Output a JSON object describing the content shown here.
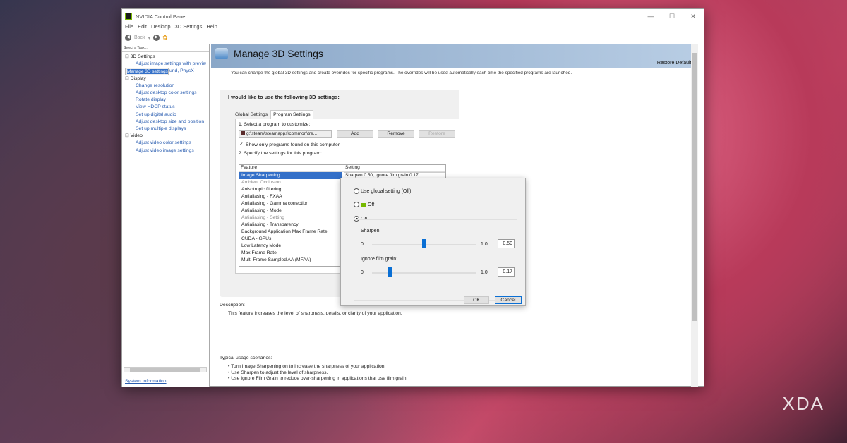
{
  "window": {
    "title": "NVIDIA Control Panel",
    "menu": [
      "File",
      "Edit",
      "Desktop",
      "3D Settings",
      "Help"
    ],
    "back": "Back"
  },
  "sidebar": {
    "header": "Select a Task...",
    "groups": [
      {
        "label": "3D Settings",
        "items": [
          "Adjust image settings with preview",
          "Manage 3D settings",
          "Configure Surround, PhysX"
        ]
      },
      {
        "label": "Display",
        "items": [
          "Change resolution",
          "Adjust desktop color settings",
          "Rotate display",
          "View HDCP status",
          "Set up digital audio",
          "Adjust desktop size and position",
          "Set up multiple displays"
        ]
      },
      {
        "label": "Video",
        "items": [
          "Adjust video color settings",
          "Adjust video image settings"
        ]
      }
    ],
    "selected": "Manage 3D settings",
    "system_info": "System Information"
  },
  "page": {
    "title": "Manage 3D Settings",
    "restore_defaults": "Restore Defaults",
    "intro": "You can change the global 3D settings and create overrides for specific programs. The overrides will be used automatically each time the specified programs are launched.",
    "panel_title": "I would like to use the following 3D settings:",
    "tabs": [
      "Global Settings",
      "Program Settings"
    ],
    "step1": "1. Select a program to customize:",
    "program": "g:\\steam\\steamapps\\common\\tre...",
    "add": "Add",
    "remove": "Remove",
    "restore": "Restore",
    "show_only": "Show only programs found on this computer",
    "step2": "2. Specify the settings for this program:",
    "col_feature": "Feature",
    "col_setting": "Setting",
    "selected_setting": "Sharpen 0.50, Ignore film grain 0.17",
    "features": [
      "Image Sharpening",
      "Ambient Occlusion",
      "Anisotropic filtering",
      "Antialiasing - FXAA",
      "Antialiasing - Gamma correction",
      "Antialiasing - Mode",
      "Antialiasing - Setting",
      "Antialiasing - Transparency",
      "Background Application Max Frame Rate",
      "CUDA - GPUs",
      "Low Latency Mode",
      "Max Frame Rate",
      "Multi-Frame Sampled AA (MFAA)"
    ],
    "description_label": "Description:",
    "description": "This feature increases the level of sharpness, details, or clarity of your application.",
    "usage_label": "Typical usage scenarios:",
    "usage": [
      "• Turn Image Sharpening on to increase the sharpness of your application.",
      "• Use Sharpen to adjust the level of sharpness.",
      "• Use Ignore Film Grain to reduce over-sharpening in applications that use film grain."
    ]
  },
  "dialog": {
    "global": "Use global setting (Off)",
    "off": "Off",
    "on": "On",
    "sharpen_label": "Sharpen:",
    "grain_label": "Ignore film grain:",
    "min": "0",
    "max": "1.0",
    "sharpen": "0.50",
    "grain": "0.17",
    "sharpen_value": 0.5,
    "grain_value": 0.17,
    "ok": "OK",
    "cancel": "Cancel"
  },
  "watermark": "XDA"
}
